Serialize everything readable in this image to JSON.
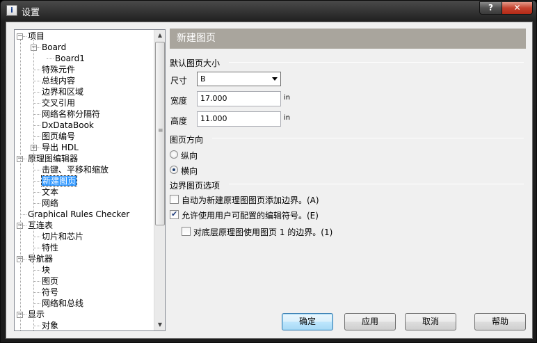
{
  "window": {
    "title": "设置",
    "icon_glyph": "i",
    "help_glyph": "?",
    "close_glyph": "✕"
  },
  "tree": {
    "items": [
      {
        "label": "项目",
        "level": 0,
        "expander": "−"
      },
      {
        "label": "Board",
        "level": 1,
        "expander": "−"
      },
      {
        "label": "Board1",
        "level": 2
      },
      {
        "label": "特殊元件",
        "level": 1
      },
      {
        "label": "总线内容",
        "level": 1
      },
      {
        "label": "边界和区域",
        "level": 1
      },
      {
        "label": "交叉引用",
        "level": 1
      },
      {
        "label": "网络名称分隔符",
        "level": 1
      },
      {
        "label": "DxDataBook",
        "level": 1
      },
      {
        "label": "图页编号",
        "level": 1
      },
      {
        "label": "导出 HDL",
        "level": 1,
        "expander": "+"
      },
      {
        "label": "原理图编辑器",
        "level": 0,
        "expander": "−"
      },
      {
        "label": "击键、平移和缩放",
        "level": 1
      },
      {
        "label": "新建图页",
        "level": 1,
        "selected": true
      },
      {
        "label": "文本",
        "level": 1
      },
      {
        "label": "网络",
        "level": 1
      },
      {
        "label": "Graphical Rules Checker",
        "level": 0
      },
      {
        "label": "互连表",
        "level": 0,
        "expander": "−"
      },
      {
        "label": "切片和芯片",
        "level": 1
      },
      {
        "label": "特性",
        "level": 1
      },
      {
        "label": "导航器",
        "level": 0,
        "expander": "−"
      },
      {
        "label": "块",
        "level": 1
      },
      {
        "label": "图页",
        "level": 1
      },
      {
        "label": "符号",
        "level": 1
      },
      {
        "label": "网络和总线",
        "level": 1
      },
      {
        "label": "显示",
        "level": 0,
        "expander": "−"
      },
      {
        "label": "对象",
        "level": 1
      }
    ]
  },
  "panel": {
    "title": "新建图页",
    "page_size": {
      "section_label": "默认图页大小",
      "size_label": "尺寸",
      "size_value": "B",
      "width_label": "宽度",
      "width_value": "17.000",
      "width_unit": "in",
      "height_label": "高度",
      "height_value": "11.000",
      "height_unit": "in"
    },
    "orientation": {
      "section_label": "图页方向",
      "portrait_label": "纵向",
      "landscape_label": "横向",
      "selected": "landscape"
    },
    "border": {
      "section_label": "边界图页选项",
      "opt_auto_border": {
        "label": "自动为新建原理图图页添加边界。(A)",
        "checked": false
      },
      "opt_user_symbols": {
        "label": "允许使用用户可配置的编辑符号。(E)",
        "checked": true
      },
      "opt_sheet1_border": {
        "label": "对底层原理图使用图页 1 的边界。(1)",
        "checked": false
      }
    }
  },
  "buttons": {
    "ok": "确定",
    "apply": "应用",
    "cancel": "取消",
    "help": "帮助"
  }
}
